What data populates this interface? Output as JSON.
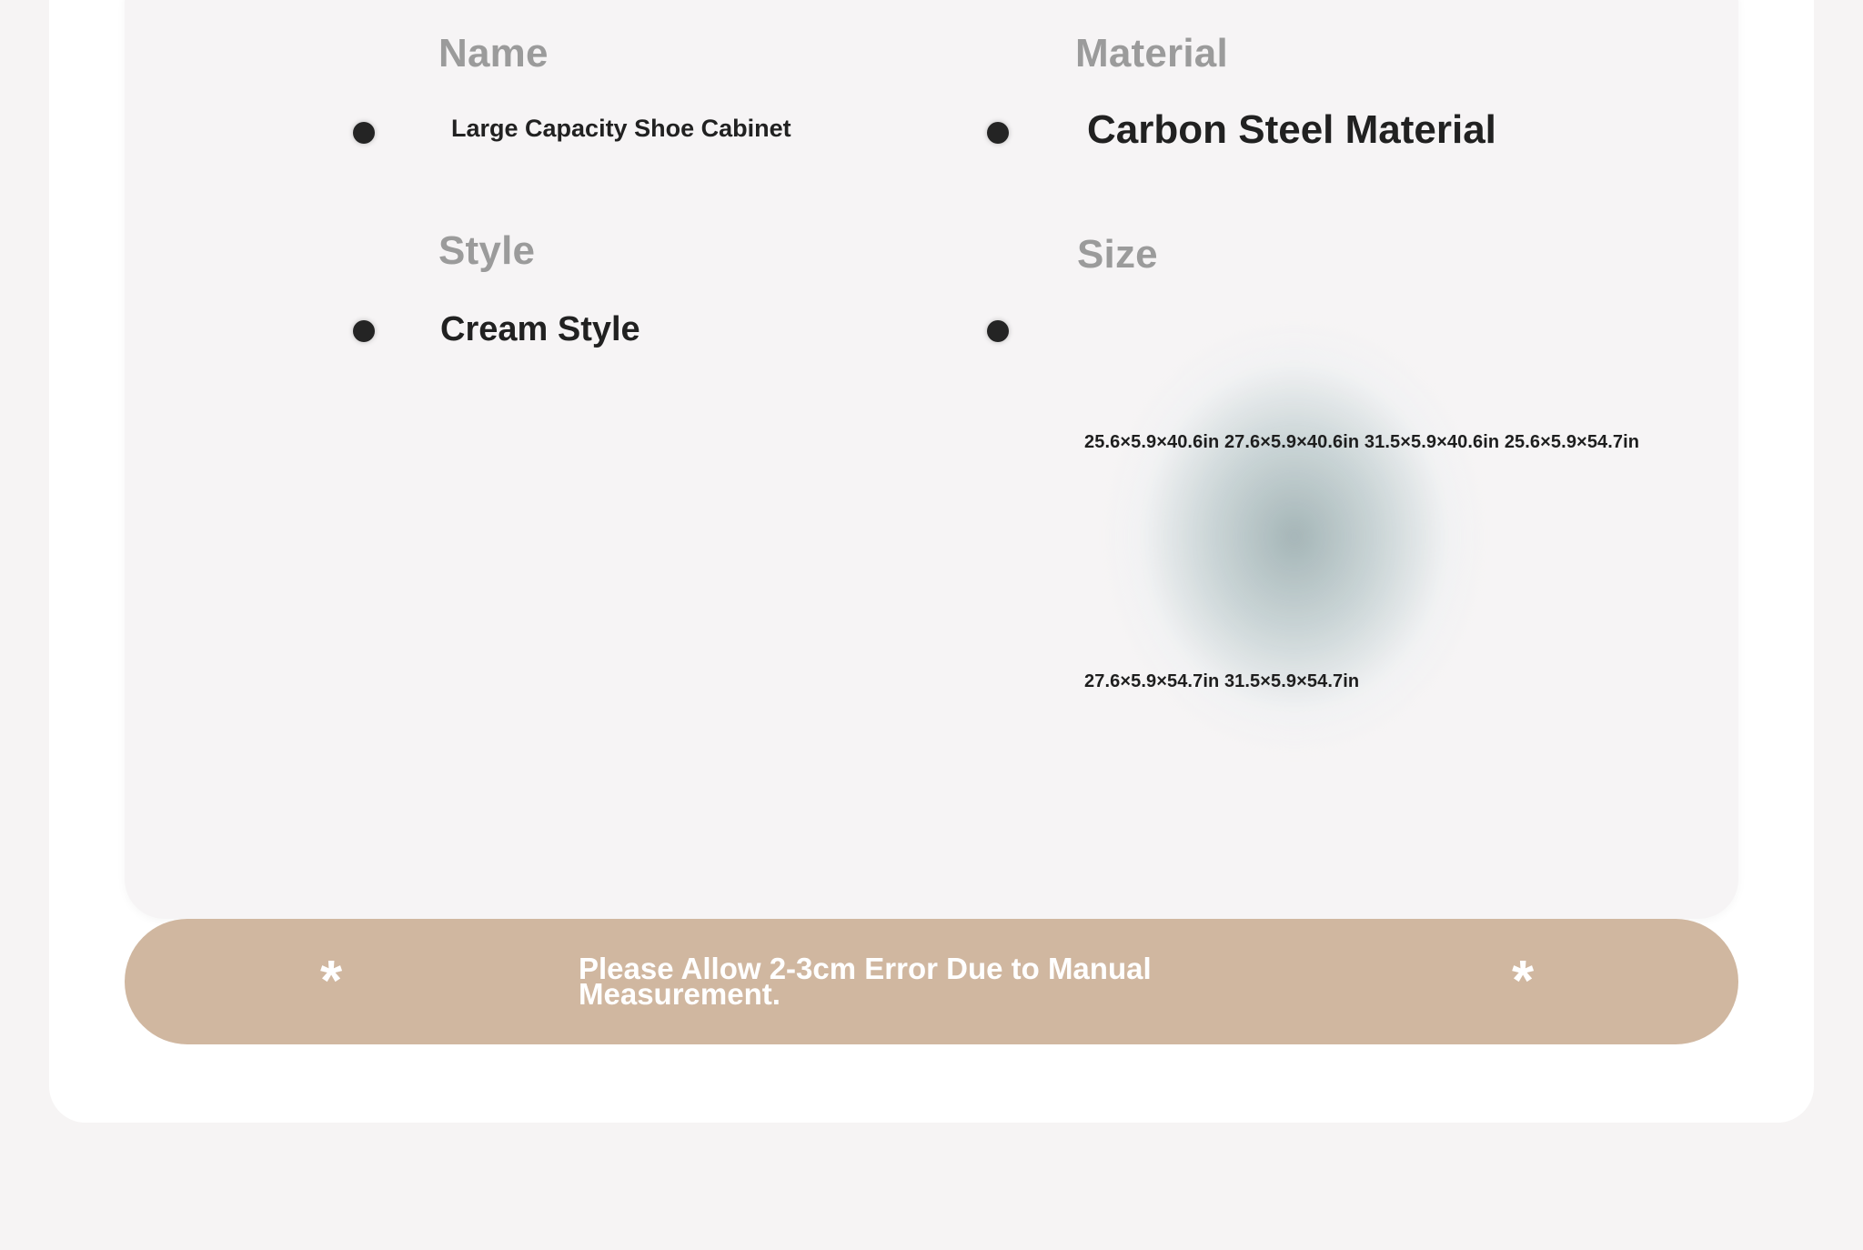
{
  "specs": {
    "name": {
      "label": "Name",
      "value": "Large Capacity Shoe Cabinet"
    },
    "material": {
      "label": "Material",
      "value": "Carbon Steel Material"
    },
    "style": {
      "label": "Style",
      "value": "Cream Style"
    },
    "size": {
      "label": "Size",
      "line1": "25.6×5.9×40.6in 27.6×5.9×40.6in 31.5×5.9×40.6in 25.6×5.9×54.7in",
      "line2": "27.6×5.9×54.7in 31.5×5.9×54.7in"
    }
  },
  "notice": {
    "text": "Please Allow 2-3cm Error Due to Manual Measurement.",
    "star_left": "*",
    "star_right": "*"
  },
  "colors": {
    "banner": "#d0b7a0",
    "label_gray": "#9b9b9b",
    "value_dark": "#212121",
    "panel": "#f6f4f5"
  }
}
